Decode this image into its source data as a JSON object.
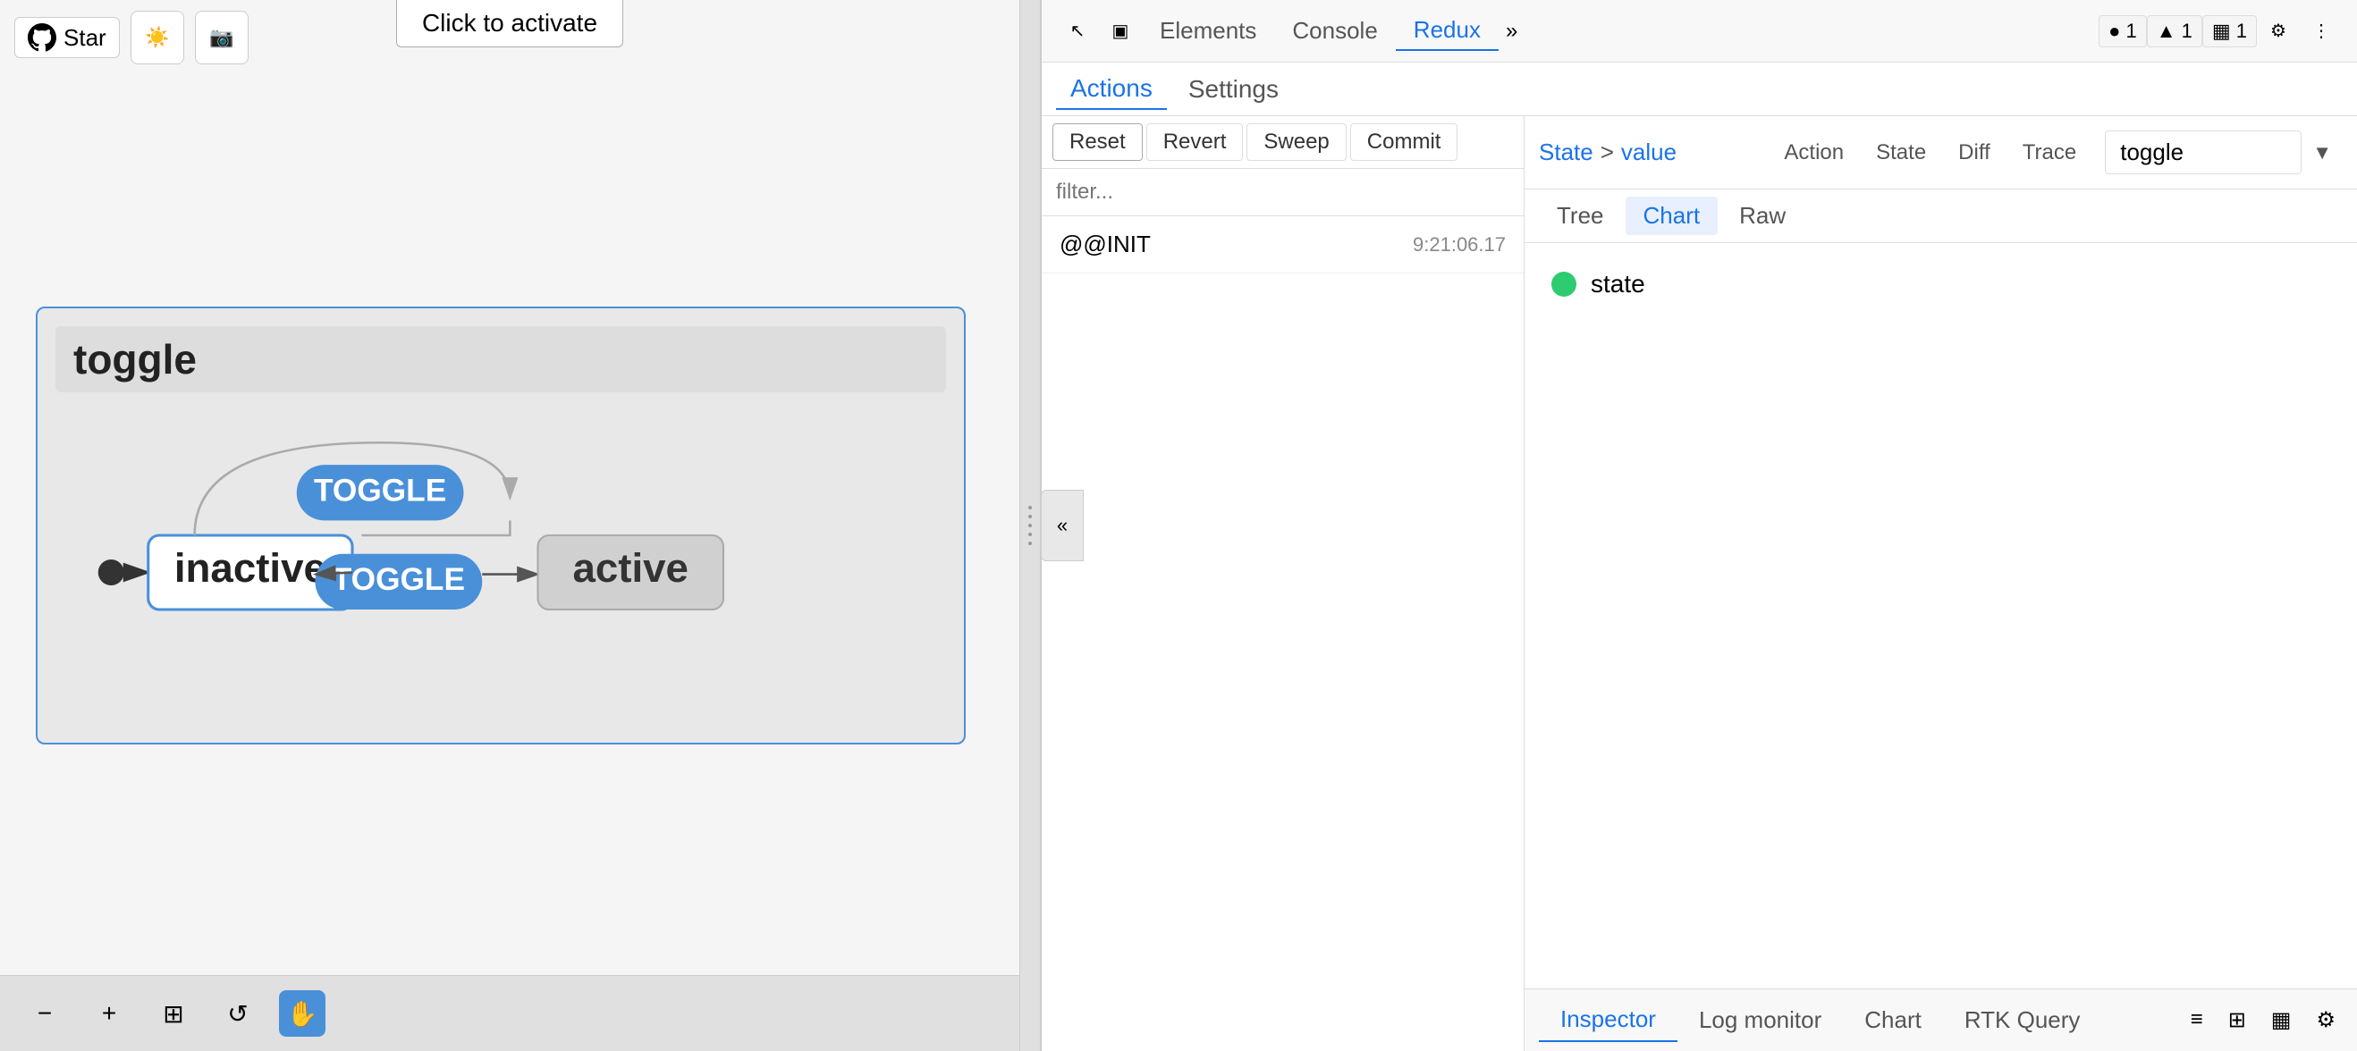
{
  "left": {
    "star_label": "Star",
    "click_to_activate": "Click to activate",
    "diagram": {
      "title": "toggle",
      "state_inactive": "inactive",
      "state_active": "active",
      "toggle_label": "TOGGLE"
    },
    "bottom_tools": {
      "minus": "−",
      "plus": "+",
      "fit": "⊞",
      "reset": "↺",
      "hand": "✋"
    }
  },
  "devtools": {
    "header": {
      "tabs": [
        "Elements",
        "Console",
        "Redux"
      ],
      "active_tab": "Redux",
      "indicators": [
        "● 1",
        "▲ 1",
        "▦ 1"
      ]
    },
    "redux": {
      "main_tabs": [
        "Actions",
        "Settings"
      ],
      "active_tab": "Actions",
      "toolbar": [
        "Reset",
        "Revert",
        "Sweep",
        "Commit"
      ],
      "filter_placeholder": "filter...",
      "toggle_search": "toggle",
      "actions": [
        {
          "name": "@@INIT",
          "time": "9:21:06.17"
        }
      ],
      "inspector": {
        "breadcrumb": [
          "State",
          ">",
          "value"
        ],
        "tabs": [
          "Action",
          "State",
          "Diff",
          "Trace"
        ],
        "view_tabs": [
          "Tree",
          "Chart",
          "Raw"
        ],
        "active_view": "Chart",
        "state_node": "state"
      }
    },
    "bottom_tabs": [
      "Inspector",
      "Log monitor",
      "Chart",
      "RTK Query"
    ],
    "active_bottom_tab": "Inspector"
  }
}
